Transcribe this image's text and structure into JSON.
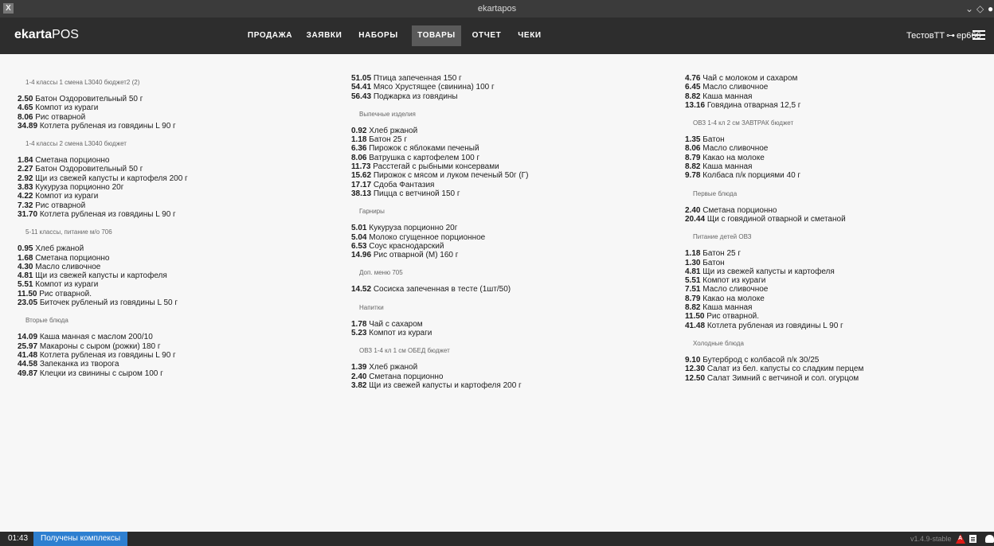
{
  "window": {
    "title": "ekartapos",
    "app_icon": "X",
    "controls": [
      "chevron-down-icon",
      "diamond-icon",
      "close-icon"
    ]
  },
  "navbar": {
    "brand_bold": "ekarta",
    "brand_rest": "POS",
    "tabs": [
      {
        "label": "ПРОДАЖА",
        "active": false
      },
      {
        "label": "ЗАЯВКИ",
        "active": false
      },
      {
        "label": "НАБОРЫ",
        "active": false
      },
      {
        "label": "ТОВАРЫ",
        "active": true
      },
      {
        "label": "ОТЧЕТ",
        "active": false
      },
      {
        "label": "ЧЕКИ",
        "active": false
      }
    ],
    "user_name": "ТестовТТ",
    "user_login": "ep666"
  },
  "columns": [
    [
      {
        "group": "1-4 классы 1 смена L3040 бюджет2 (2)",
        "items": [
          {
            "price": "2.50",
            "name": "Батон Оздоровительный 50 г"
          },
          {
            "price": "4.65",
            "name": "Компот из кураги"
          },
          {
            "price": "8.06",
            "name": "Рис отварной"
          },
          {
            "price": "34.89",
            "name": "Котлета рубленая из говядины L 90 г"
          }
        ]
      },
      {
        "group": "1-4 классы 2 смена L3040 бюджет",
        "items": [
          {
            "price": "1.84",
            "name": "Сметана порционно"
          },
          {
            "price": "2.27",
            "name": "Батон Оздоровительный 50 г"
          },
          {
            "price": "2.92",
            "name": "Щи из свежей капусты и картофеля 200 г"
          },
          {
            "price": "3.83",
            "name": "Кукуруза порционно 20г"
          },
          {
            "price": "4.22",
            "name": "Компот из кураги"
          },
          {
            "price": "7.32",
            "name": "Рис отварной"
          },
          {
            "price": "31.70",
            "name": "Котлета рубленая из говядины L 90 г"
          }
        ]
      },
      {
        "group": "5-11 классы, питание м/о 706",
        "items": [
          {
            "price": "0.95",
            "name": "Хлеб ржаной"
          },
          {
            "price": "1.68",
            "name": "Сметана порционно"
          },
          {
            "price": "4.30",
            "name": "Масло сливочное"
          },
          {
            "price": "4.81",
            "name": "Щи из свежей капусты и картофеля"
          },
          {
            "price": "5.51",
            "name": "Компот из кураги"
          },
          {
            "price": "11.50",
            "name": "Рис отварной."
          },
          {
            "price": "23.05",
            "name": "Биточек рубленый из говядины L 50 г"
          }
        ]
      },
      {
        "group": "Вторые блюда",
        "items": [
          {
            "price": "14.09",
            "name": "Каша манная с маслом 200/10"
          },
          {
            "price": "25.97",
            "name": "Макароны с сыром (рожки) 180 г"
          },
          {
            "price": "41.48",
            "name": "Котлета рубленая из говядины L 90 г"
          },
          {
            "price": "44.58",
            "name": "Запеканка из творога"
          },
          {
            "price": "49.87",
            "name": "Клецки из свинины с сыром 100 г"
          }
        ]
      }
    ],
    [
      {
        "group": "",
        "items": [
          {
            "price": "51.05",
            "name": "Птица запеченная 150 г"
          },
          {
            "price": "54.41",
            "name": "Мясо Хрустящее (свинина) 100 г"
          },
          {
            "price": "56.43",
            "name": "Поджарка из говядины"
          }
        ]
      },
      {
        "group": "Выпечные изделия",
        "items": [
          {
            "price": "0.92",
            "name": "Хлеб ржаной"
          },
          {
            "price": "1.18",
            "name": "Батон 25 г"
          },
          {
            "price": "6.36",
            "name": "Пирожок с яблоками печеный"
          },
          {
            "price": "8.06",
            "name": "Ватрушка с картофелем 100 г"
          },
          {
            "price": "11.73",
            "name": "Расстегай с рыбными консервами"
          },
          {
            "price": "15.62",
            "name": "Пирожок с мясом и луком печеный 50г (Г)"
          },
          {
            "price": "17.17",
            "name": "Сдоба Фантазия"
          },
          {
            "price": "38.13",
            "name": "Пицца с ветчиной 150 г"
          }
        ]
      },
      {
        "group": "Гарниры",
        "items": [
          {
            "price": "5.01",
            "name": "Кукуруза порционно 20г"
          },
          {
            "price": "5.04",
            "name": "Молоко сгущенное порционное"
          },
          {
            "price": "6.53",
            "name": "Соус краснодарский"
          },
          {
            "price": "14.96",
            "name": "Рис отварной (М) 160 г"
          }
        ]
      },
      {
        "group": "Доп. меню 705",
        "items": [
          {
            "price": "14.52",
            "name": "Сосиска запеченная в тесте (1шт/50)"
          }
        ]
      },
      {
        "group": "Напитки",
        "items": [
          {
            "price": "1.78",
            "name": "Чай с сахаром"
          },
          {
            "price": "5.23",
            "name": "Компот из кураги"
          }
        ]
      },
      {
        "group": "ОВЗ 1-4 кл 1 см ОБЕД бюджет",
        "items": [
          {
            "price": "1.39",
            "name": "Хлеб ржаной"
          },
          {
            "price": "2.40",
            "name": "Сметана порционно"
          },
          {
            "price": "3.82",
            "name": "Щи из свежей капусты и картофеля 200 г"
          }
        ]
      }
    ],
    [
      {
        "group": "",
        "items": [
          {
            "price": "4.76",
            "name": "Чай с молоком и сахаром"
          },
          {
            "price": "6.45",
            "name": "Масло сливочное"
          },
          {
            "price": "8.82",
            "name": "Каша манная"
          },
          {
            "price": "13.16",
            "name": "Говядина отварная 12,5 г"
          }
        ]
      },
      {
        "group": "ОВЗ 1-4 кл 2 см ЗАВТРАК бюджет",
        "items": [
          {
            "price": "1.35",
            "name": "Батон"
          },
          {
            "price": "8.06",
            "name": "Масло сливочное"
          },
          {
            "price": "8.79",
            "name": "Какао на молоке"
          },
          {
            "price": "8.82",
            "name": "Каша манная"
          },
          {
            "price": "9.78",
            "name": "Колбаса п/к порциями 40 г"
          }
        ]
      },
      {
        "group": "Первые блюда",
        "items": [
          {
            "price": "2.40",
            "name": "Сметана порционно"
          },
          {
            "price": "20.44",
            "name": "Щи с говядиной отварной и сметаной"
          }
        ]
      },
      {
        "group": "Питание детей ОВЗ",
        "items": [
          {
            "price": "1.18",
            "name": "Батон 25 г"
          },
          {
            "price": "1.30",
            "name": "Батон"
          },
          {
            "price": "4.81",
            "name": "Щи из свежей капусты и картофеля"
          },
          {
            "price": "5.51",
            "name": "Компот из кураги"
          },
          {
            "price": "7.51",
            "name": "Масло сливочное"
          },
          {
            "price": "8.79",
            "name": "Какао на молоке"
          },
          {
            "price": "8.82",
            "name": "Каша манная"
          },
          {
            "price": "11.50",
            "name": "Рис отварной."
          },
          {
            "price": "41.48",
            "name": "Котлета рубленая из говядины L 90 г"
          }
        ]
      },
      {
        "group": "Холодные блюда",
        "items": [
          {
            "price": "9.10",
            "name": "Бутерброд с колбасой п/к 30/25"
          },
          {
            "price": "12.30",
            "name": "Салат из бел. капусты со сладким перцем"
          },
          {
            "price": "12.50",
            "name": "Салат Зимний с ветчиной и сол. огурцом"
          }
        ]
      }
    ]
  ],
  "statusbar": {
    "time": "01:43",
    "message": "Получены комплексы",
    "version": "v1.4.9-stable",
    "accent": "#2e7fd0"
  }
}
